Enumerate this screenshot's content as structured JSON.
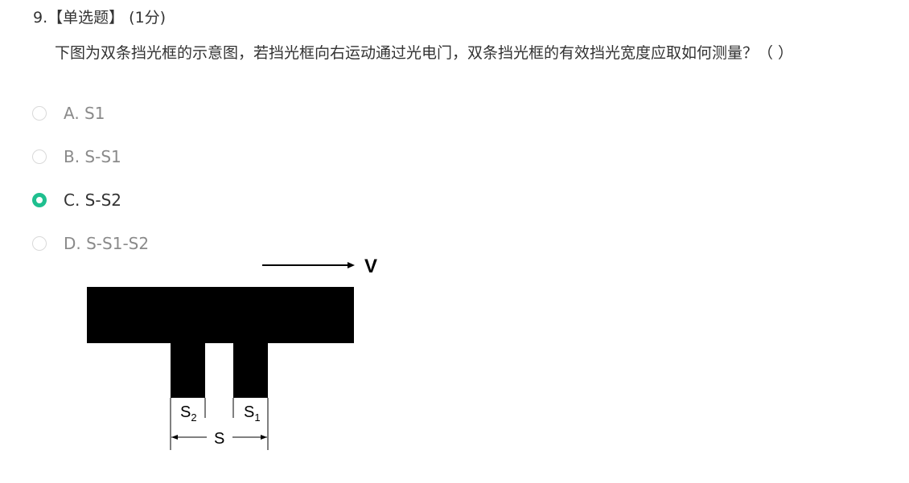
{
  "question": {
    "number": "9.",
    "type_label": "【单选题】",
    "score": "(1分)",
    "text": "下图为双条挡光框的示意图，若挡光框向右运动通过光电门，双条挡光框的有效挡光宽度应取如何测量？（ ）"
  },
  "options": [
    {
      "label": "A. S1",
      "selected": false
    },
    {
      "label": "B. S-S1",
      "selected": false
    },
    {
      "label": "C. S-S2",
      "selected": true
    },
    {
      "label": "D. S-S1-S2",
      "selected": false
    }
  ],
  "figure": {
    "velocity_label": "V",
    "s_label": "S",
    "s1_label": "S",
    "s1_subscript": "1",
    "s2_label": "S",
    "s2_subscript": "2"
  },
  "colors": {
    "selected_radio": "#1fbf8f",
    "unselected_radio_border": "#d9d9d9",
    "text_primary": "#333333",
    "text_muted": "#8a8a8a"
  }
}
